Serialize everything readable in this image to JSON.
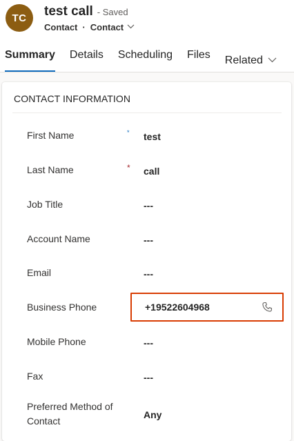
{
  "header": {
    "avatar_initials": "TC",
    "title": "test call",
    "saved_status": "- Saved",
    "entity_type": "Contact",
    "separator": "·",
    "form_name": "Contact"
  },
  "tabs": [
    {
      "label": "Summary",
      "active": true
    },
    {
      "label": "Details",
      "active": false
    },
    {
      "label": "Scheduling",
      "active": false
    },
    {
      "label": "Files",
      "active": false
    },
    {
      "label": "Related",
      "active": false
    }
  ],
  "section": {
    "title": "CONTACT INFORMATION"
  },
  "fields": [
    {
      "label": "First Name",
      "value": "test",
      "required": "*"
    },
    {
      "label": "Last Name",
      "value": "call",
      "required": "*"
    },
    {
      "label": "Job Title",
      "value": "---"
    },
    {
      "label": "Account Name",
      "value": "---"
    },
    {
      "label": "Email",
      "value": "---"
    },
    {
      "label": "Business Phone",
      "value": "+19522604968"
    },
    {
      "label": "Mobile Phone",
      "value": "---"
    },
    {
      "label": "Fax",
      "value": "---"
    },
    {
      "label": "Preferred Method of Contact",
      "value": "Any"
    }
  ],
  "icons": {
    "form_switcher": "chevron-down-icon",
    "related_menu": "chevron-down-icon",
    "call": "phone-icon"
  },
  "colors": {
    "avatar": "#8c5d12",
    "active_tab_underline": "#0f6cbd",
    "required_marker": "#a4262c",
    "highlight_border": "#d83b01"
  }
}
